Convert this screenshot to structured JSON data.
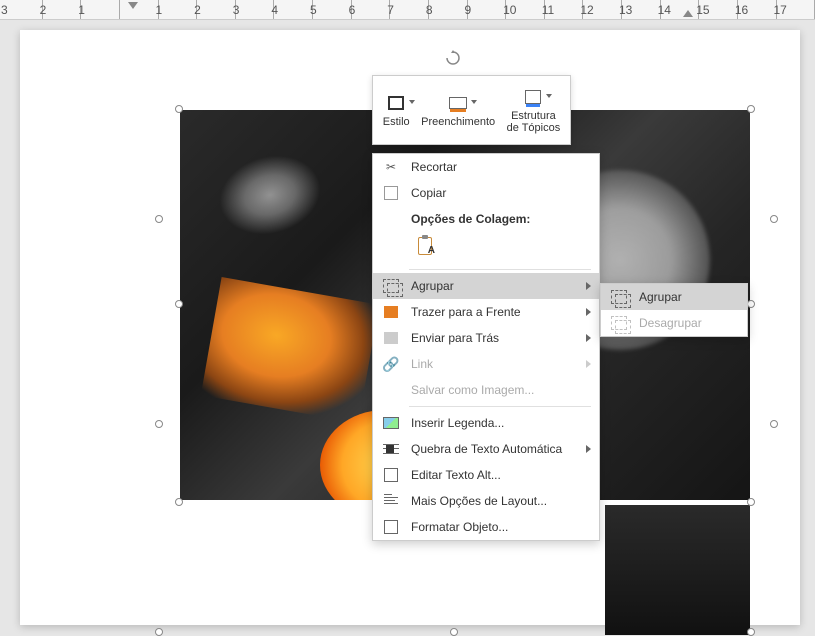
{
  "ruler": {
    "marks": [
      "3",
      "2",
      "1",
      "",
      "1",
      "2",
      "3",
      "4",
      "5",
      "6",
      "7",
      "8",
      "9",
      "10",
      "11",
      "12",
      "13",
      "14",
      "15",
      "16",
      "17"
    ]
  },
  "toolbar": {
    "estilo": "Estilo",
    "preenchimento": "Preenchimento",
    "estrutura": "Estrutura\nde Tópicos"
  },
  "menu": {
    "recortar": "Recortar",
    "copiar": "Copiar",
    "opcoes_colagem": "Opções de Colagem:",
    "agrupar": "Agrupar",
    "trazer_frente": "Trazer para a Frente",
    "enviar_tras": "Enviar para Trás",
    "link": "Link",
    "salvar_imagem": "Salvar como Imagem...",
    "inserir_legenda": "Inserir Legenda...",
    "quebra_texto": "Quebra de Texto Automática",
    "editar_alt": "Editar Texto Alt...",
    "mais_opcoes": "Mais Opções de Layout...",
    "formatar_objeto": "Formatar Objeto..."
  },
  "submenu": {
    "agrupar": "Agrupar",
    "desagrupar": "Desagrupar"
  }
}
